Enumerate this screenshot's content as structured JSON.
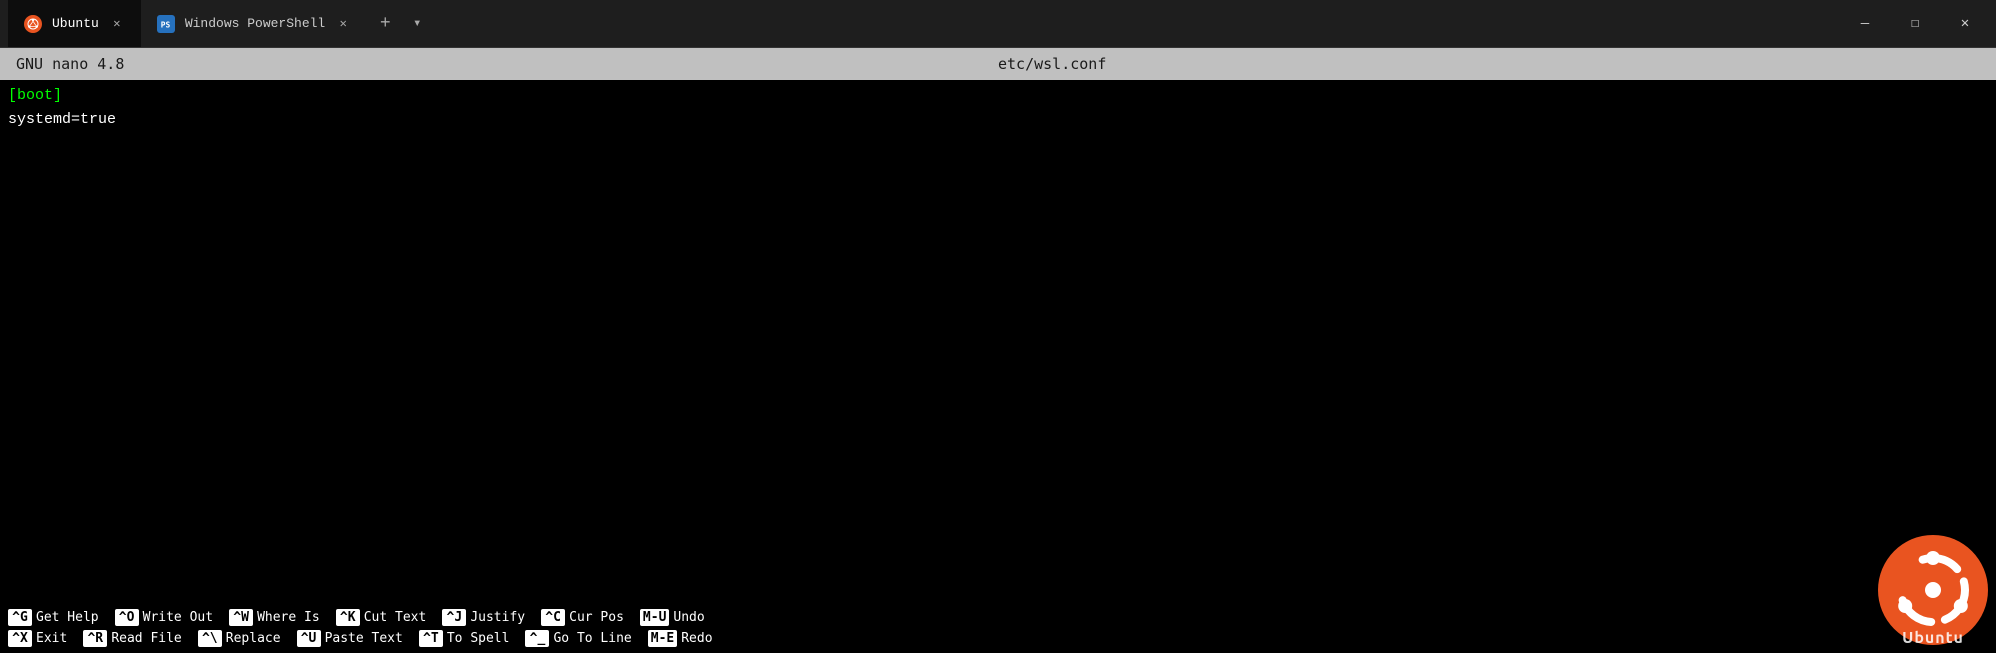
{
  "titlebar": {
    "tabs": [
      {
        "id": "ubuntu",
        "label": "Ubuntu",
        "icon": "ubuntu",
        "active": true
      },
      {
        "id": "powershell",
        "label": "Windows PowerShell",
        "icon": "powershell",
        "active": false
      }
    ],
    "add_label": "+",
    "dropdown_label": "▾",
    "controls": {
      "minimize": "—",
      "maximize": "☐",
      "close": "✕"
    }
  },
  "nano": {
    "header_left": "GNU nano 4.8",
    "header_center": "etc/wsl.conf"
  },
  "editor": {
    "lines": [
      {
        "text": "[boot]",
        "type": "boot"
      },
      {
        "text": "systemd=true",
        "type": "normal"
      }
    ]
  },
  "shortcuts": {
    "row1": [
      {
        "key": "^G",
        "label": "Get Help"
      },
      {
        "key": "^O",
        "label": "Write Out"
      },
      {
        "key": "^W",
        "label": "Where Is"
      },
      {
        "key": "^K",
        "label": "Cut Text"
      },
      {
        "key": "^J",
        "label": "Justify"
      },
      {
        "key": "^C",
        "label": "Cur Pos"
      },
      {
        "key": "M-U",
        "label": "Undo"
      }
    ],
    "row2": [
      {
        "key": "^X",
        "label": "Exit"
      },
      {
        "key": "^R",
        "label": "Read File"
      },
      {
        "key": "^\\",
        "label": "Replace"
      },
      {
        "key": "^U",
        "label": "Paste Text"
      },
      {
        "key": "^T",
        "label": "To Spell"
      },
      {
        "key": "^_",
        "label": "Go To Line"
      },
      {
        "key": "M-E",
        "label": "Redo"
      }
    ]
  },
  "ubuntu_logo": {
    "text": "Ubuntu"
  }
}
